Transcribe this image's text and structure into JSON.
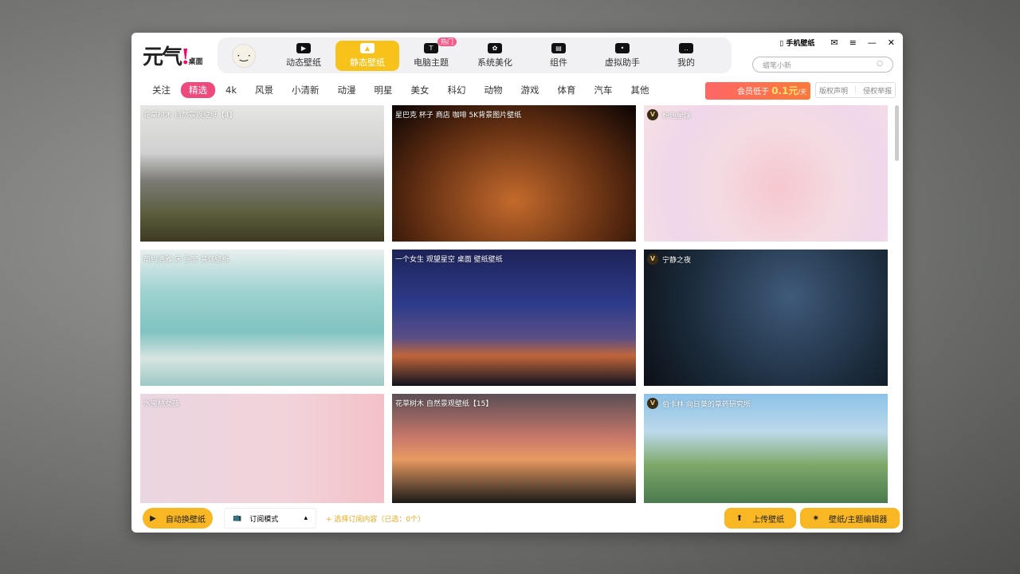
{
  "app": {
    "logo_text": "元气",
    "logo_sub": "桌面"
  },
  "nav": {
    "items": [
      {
        "label": "动态壁纸",
        "icon": "tv-play-icon"
      },
      {
        "label": "静态壁纸",
        "icon": "image-icon",
        "active": true
      },
      {
        "label": "电脑主题",
        "icon": "shirt-icon",
        "badge": "热门"
      },
      {
        "label": "系统美化",
        "icon": "flower-icon"
      },
      {
        "label": "组件",
        "icon": "widget-icon"
      },
      {
        "label": "虚拟助手",
        "icon": "paw-icon"
      },
      {
        "label": "我的",
        "icon": "face-icon"
      }
    ]
  },
  "top_right": {
    "phone_wallpaper": "手机壁纸",
    "search_placeholder": "蜡笔小新"
  },
  "categories": [
    "关注",
    "精选",
    "4k",
    "风景",
    "小清新",
    "动漫",
    "明星",
    "美女",
    "科幻",
    "动物",
    "游戏",
    "体育",
    "汽车",
    "其他"
  ],
  "active_category": "精选",
  "vip": {
    "text": "会员低于",
    "price": "0.1元",
    "unit": "/天"
  },
  "rights": {
    "statement": "版权声明",
    "report": "侵权举报"
  },
  "wallpapers": [
    {
      "title": "花草树木 自然景观壁纸【4】",
      "vip": false
    },
    {
      "title": "星巴克 杯子 商店 咖啡 5K背景图片壁纸",
      "vip": false
    },
    {
      "title": "粉色星球",
      "vip": true
    },
    {
      "title": "简约清雅 床 卧室 装饰壁纸",
      "vip": false
    },
    {
      "title": "一个女生 观望星空 桌面 壁纸壁纸",
      "vip": false
    },
    {
      "title": "宁静之夜",
      "vip": true
    },
    {
      "title": "水蜜桃女孩",
      "vip": false
    },
    {
      "title": "花草树木 自然景观壁纸【15】",
      "vip": false
    },
    {
      "title": "伯卡林 向日葵的草药研究所",
      "vip": true
    }
  ],
  "bottom": {
    "auto_change": "自动换壁纸",
    "mode": "订阅模式",
    "select_sub": "+ 选择订阅内容（已选：0个）",
    "upload": "上传壁纸",
    "editor": "壁纸/主题编辑器"
  },
  "colors": {
    "accent": "#f7c21a",
    "pink": "#ee4a7e"
  }
}
